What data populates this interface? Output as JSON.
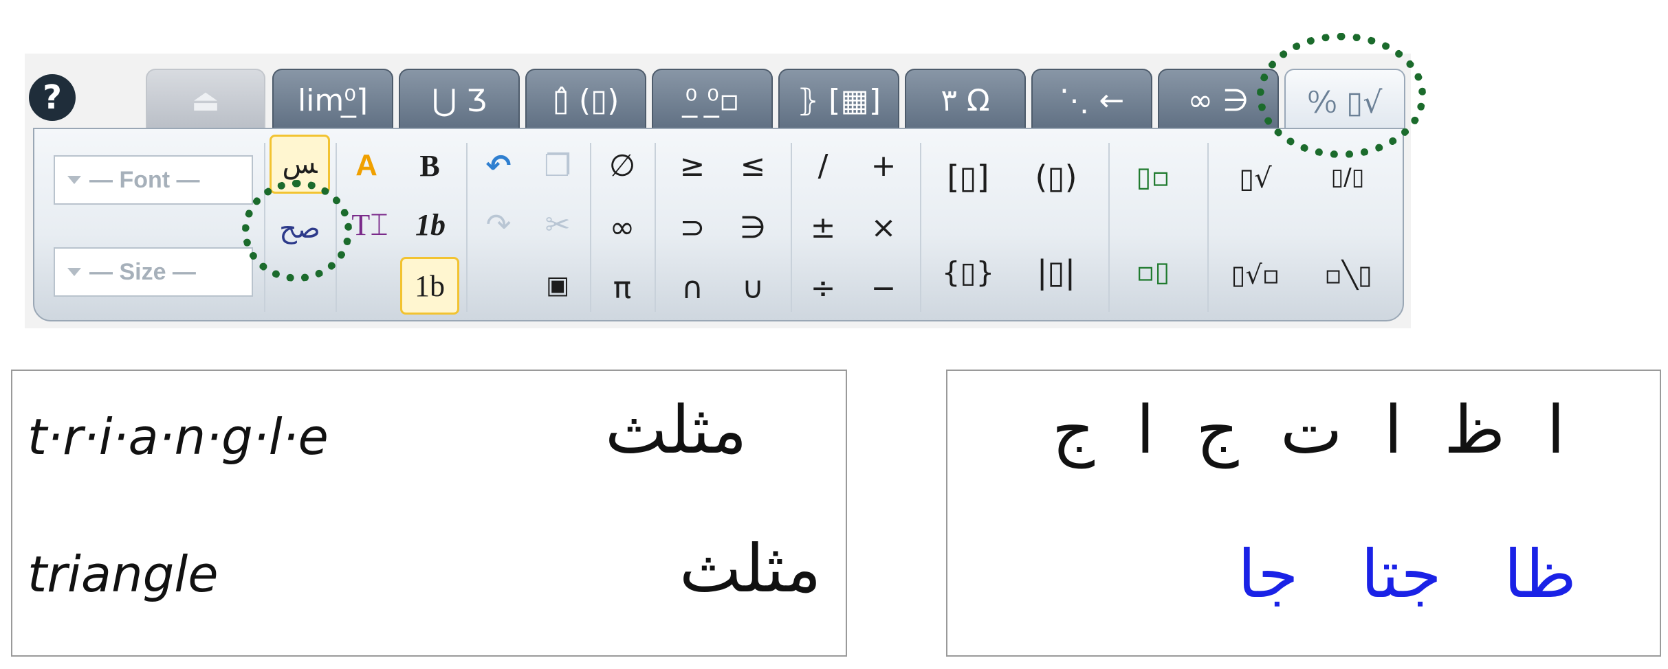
{
  "toolbar": {
    "help_label": "?",
    "tabs": [
      {
        "label": "⏏",
        "state": "disabled"
      },
      {
        "label": "lim⁰̲⌉",
        "state": "normal"
      },
      {
        "label": "⋃ Ʒ",
        "state": "normal"
      },
      {
        "label": "▯̂ (▯)",
        "state": "normal"
      },
      {
        "label": "⁰̲ ⁰̲▫",
        "state": "normal"
      },
      {
        "label": "⦄ [▦]",
        "state": "normal"
      },
      {
        "label": "٣ Ω",
        "state": "normal"
      },
      {
        "label": "⋱ ←",
        "state": "normal"
      },
      {
        "label": "∞ ∋",
        "state": "normal"
      },
      {
        "label": "⁰⁄₀ ▯√",
        "state": "active"
      }
    ],
    "font_dropdown": "— Font —",
    "size_dropdown": "— Size —",
    "bold": "B",
    "italic_1b": "1b",
    "upright_1b": "1b",
    "text_tool": "T⌶",
    "arabic_tool_top": "ﺲ",
    "arabic_tool_bottom": "ﺻﺢ",
    "symbols": {
      "empty_set": "∅",
      "geq": "≥",
      "leq": "≤",
      "slash": "/",
      "plus": "+",
      "infinity": "∞",
      "superset": "⊃",
      "ni": "∋",
      "plusminus": "±",
      "times": "×",
      "pi": "π",
      "cap": "∩",
      "cup": "∪",
      "divide": "÷",
      "minus": "−"
    },
    "brackets": {
      "square": "[▯]",
      "paren": "(▯)",
      "brace": "{▯}",
      "abs": "|▯|"
    },
    "scripts": {
      "superscript": "▯▫",
      "subscript": "▫▯"
    },
    "radicals": {
      "sqrt": "▯√",
      "fraction": "▯/▯",
      "nth_root": "▯√▫",
      "rtl_root": "▫╲▯"
    },
    "colors": {
      "tab_dark": "#6b7b8e",
      "highlight": "#f2c331",
      "dotted_circle": "#1b6b2c"
    }
  },
  "examples": {
    "left": {
      "latin_spaced": "t·r·i·a·n·g·l·e",
      "arabic_joined_mark": "مثلث",
      "latin": "triangle",
      "arabic": "مثلث"
    },
    "right": {
      "isolated": "ا ظ ا ت ج ا ج",
      "joined": "ظا جتا جا",
      "joined_color": "#1a22e6"
    }
  }
}
